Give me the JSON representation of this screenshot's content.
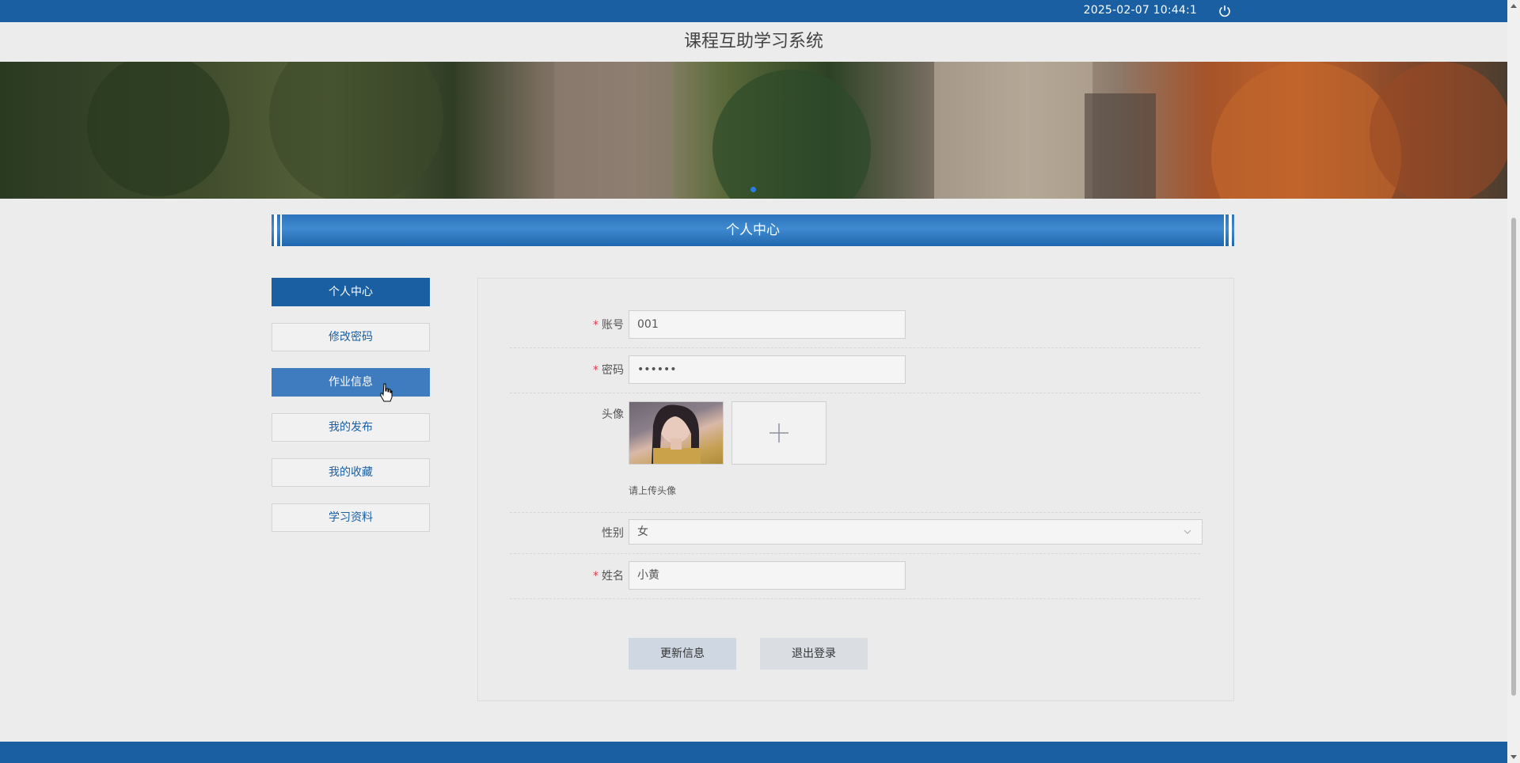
{
  "topbar": {
    "datetime": "2025-02-07   10:44:1",
    "power_icon": "power-icon"
  },
  "header": {
    "title": "课程互助学习系统"
  },
  "section": {
    "title": "个人中心"
  },
  "sidebar": {
    "items": [
      {
        "label": "个人中心"
      },
      {
        "label": "修改密码"
      },
      {
        "label": "作业信息"
      },
      {
        "label": "我的发布"
      },
      {
        "label": "我的收藏"
      },
      {
        "label": "学习资料"
      }
    ]
  },
  "form": {
    "account": {
      "label": "账号",
      "value": "001"
    },
    "password": {
      "label": "密码",
      "value": "••••••"
    },
    "avatar": {
      "label": "头像",
      "hint": "请上传头像"
    },
    "gender": {
      "label": "性别",
      "value": "女"
    },
    "name": {
      "label": "姓名",
      "value": "小黄"
    },
    "required_mark": "*"
  },
  "actions": {
    "update_label": "更新信息",
    "logout_label": "退出登录"
  },
  "colors": {
    "primary": "#1b5fa3",
    "required": "#e0394b",
    "active_item": "#1b5fa3",
    "hover_item": "#3f7bbf"
  }
}
